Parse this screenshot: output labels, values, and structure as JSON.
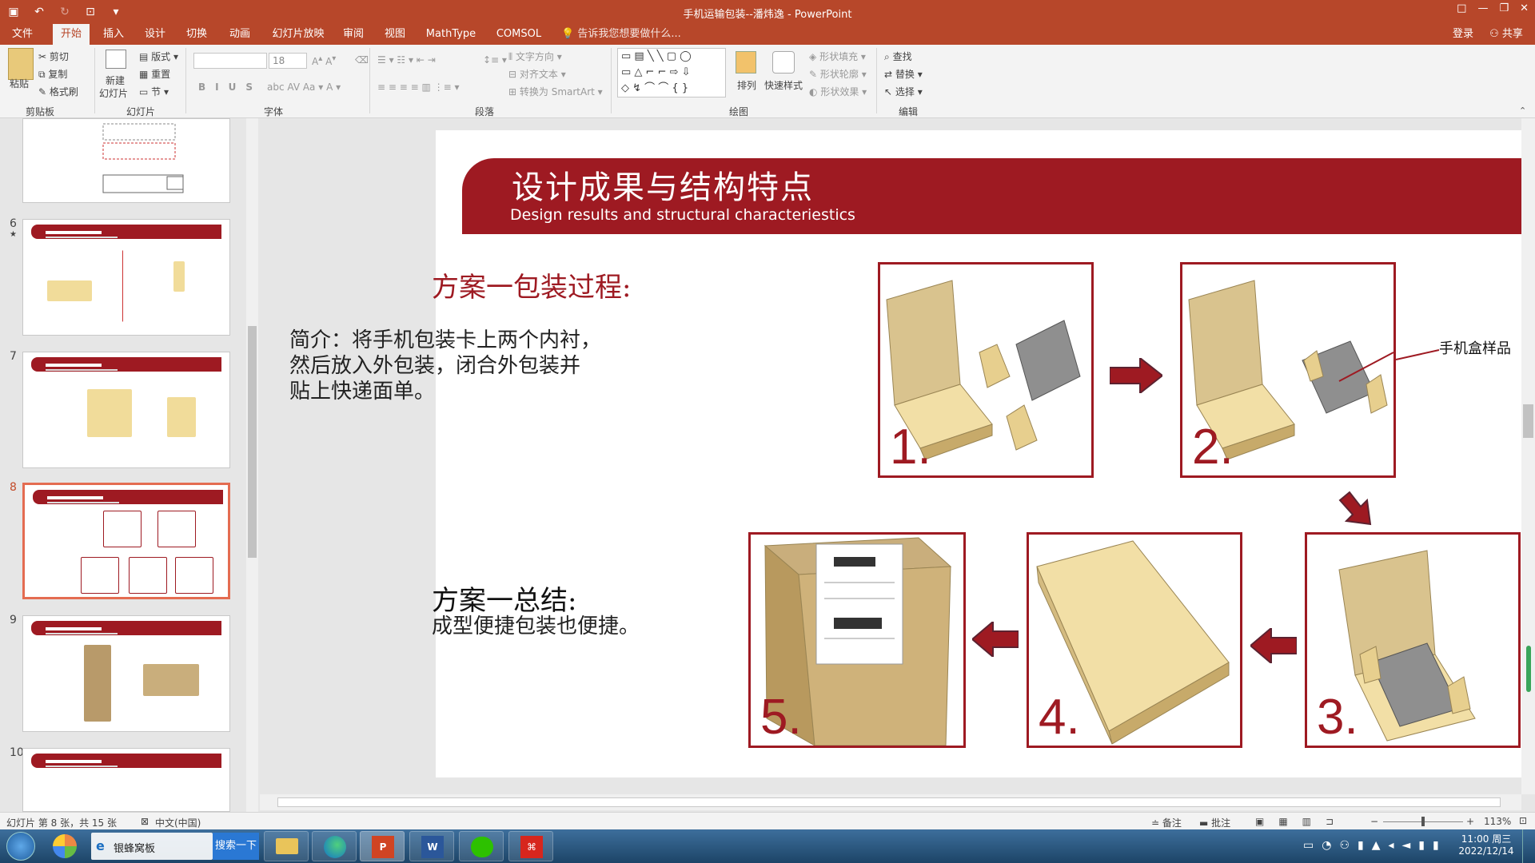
{
  "window": {
    "title": "手机运输包装--潘炜逸 - PowerPoint",
    "controls": [
      "□",
      "—",
      "❐",
      "✕"
    ]
  },
  "tabs": [
    "文件",
    "开始",
    "插入",
    "设计",
    "切换",
    "动画",
    "幻灯片放映",
    "审阅",
    "视图",
    "MathType",
    "COMSOL"
  ],
  "tell_me": "告诉我您想要做什么...",
  "account": {
    "login": "登录",
    "share": "共享"
  },
  "ribbon": {
    "clipboard": {
      "paste": "粘贴",
      "cut": "剪切",
      "copy": "复制",
      "format_painter": "格式刷",
      "label": "剪贴板"
    },
    "slides": {
      "new_slide": "新建",
      "new_slide2": "幻灯片",
      "layout": "版式",
      "reset": "重置",
      "section": "节",
      "label": "幻灯片"
    },
    "font": {
      "name": "",
      "size": "18",
      "label": "字体"
    },
    "paragraph": {
      "text_direction": "文字方向",
      "align_text": "对齐文本",
      "convert_smartart": "转换为 SmartArt",
      "label": "段落"
    },
    "drawing": {
      "arrange": "排列",
      "quick_styles": "快速样式",
      "shape_fill": "形状填充",
      "shape_outline": "形状轮廓",
      "shape_effects": "形状效果",
      "label": "绘图"
    },
    "editing": {
      "find": "查找",
      "replace": "替换",
      "select": "选择",
      "label": "编辑"
    }
  },
  "thumbnails": [
    {
      "num": "",
      "selected": false
    },
    {
      "num": "6",
      "selected": false
    },
    {
      "num": "7",
      "selected": false
    },
    {
      "num": "8",
      "selected": true
    },
    {
      "num": "9",
      "selected": false
    },
    {
      "num": "10",
      "selected": false
    }
  ],
  "slide": {
    "title_cn": "设计成果与结构特点",
    "title_en": "Design results and structural characteriestics",
    "process_heading": "方案一包装过程:",
    "intro": [
      "简介：将手机包装卡上两个内衬，",
      "然后放入外包装，闭合外包装并",
      "贴上快递面单。"
    ],
    "summary_heading": "方案一总结:",
    "summary_text": "成型便捷包装也便捷。",
    "callout": "手机盒样品",
    "steps": [
      "1.",
      "2.",
      "3.",
      "4.",
      "5."
    ]
  },
  "status": {
    "slide_info": "幻灯片 第 8 张，共 15 张",
    "language": "中文(中国)",
    "notes": "备注",
    "comments": "批注",
    "zoom": "113%"
  },
  "taskbar": {
    "ie_tab": "银蜂窝板",
    "search_btn": "搜索一下",
    "time": "11:00 周三",
    "date": "2022/12/14"
  },
  "colors": {
    "accent": "#b7472a",
    "slide_red": "#9e1a22",
    "box": "#d9c38e"
  }
}
